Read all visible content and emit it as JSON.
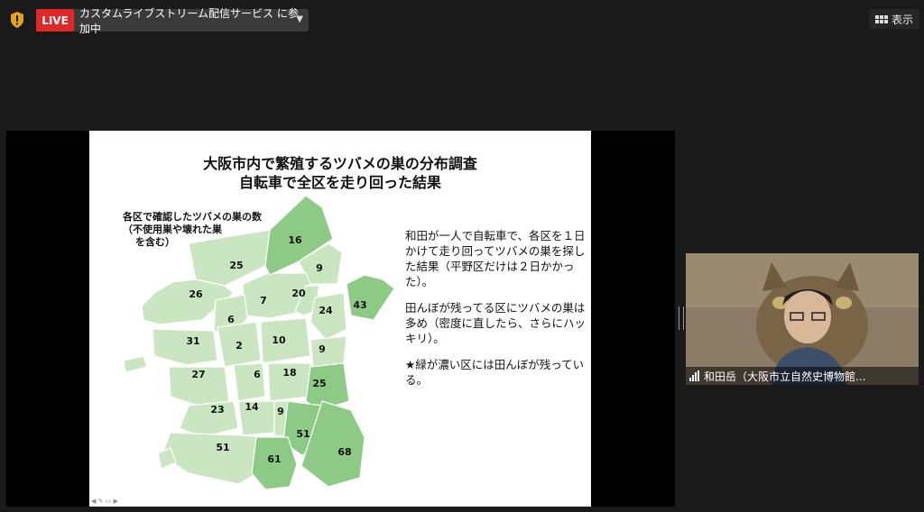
{
  "topbar": {
    "live_label": "LIVE",
    "live_status": "カスタムライブストリーム配信サービス に参加中",
    "view_label": "表示"
  },
  "slide": {
    "title_line1": "大阪市内で繁殖するツバメの巣の分布調査",
    "title_line2": "自転車で全区を走り回った結果",
    "map_caption_line1": "各区で確認したツバメの巣の数",
    "map_caption_line2": "（不使用巣や壊れた巣",
    "map_caption_line3": "を含む）",
    "body_para1": "和田が一人で自転車で、各区を１日かけて走り回ってツバメの巣を探した結果（平野区だけは２日かかった）。",
    "body_para2": "田んぼが残ってる区にツバメの巣は多め（密度に直したら、さらにハッキリ）。",
    "body_para3": "★緑が濃い区には田んぼが残っている。",
    "ward_counts": [
      "16",
      "25",
      "9",
      "26",
      "7",
      "20",
      "43",
      "6",
      "24",
      "31",
      "2",
      "10",
      "9",
      "27",
      "6",
      "18",
      "25",
      "23",
      "14",
      "9",
      "51",
      "51",
      "61",
      "68"
    ],
    "colors": {
      "light_green": "#c9e6c0",
      "dark_green": "#8dca86",
      "border": "#ffffff"
    }
  },
  "participant": {
    "name": "和田岳（大阪市立自然史博物館..."
  },
  "icons": {
    "shield": "shield-icon",
    "chevron": "chevron-down-icon",
    "view_grid": "grid-icon",
    "signal": "signal-bars-icon"
  }
}
